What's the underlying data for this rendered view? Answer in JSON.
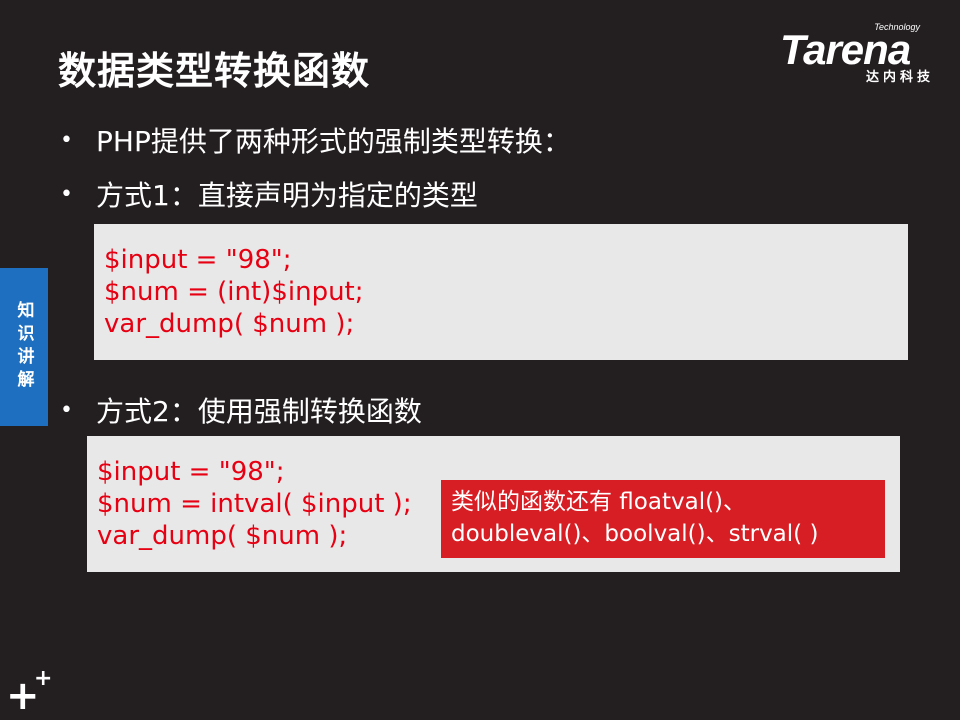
{
  "slide": {
    "title": "数据类型转换函数",
    "logo": {
      "word": "Tarena",
      "tagline": "Technology",
      "subtitle": "达内科技"
    },
    "side_tab": "知识讲解",
    "bullets": [
      "PHP提供了两种形式的强制类型转换：",
      "方式1：直接声明为指定的类型",
      "方式2：使用强制转换函数"
    ],
    "code_block_1": [
      "$input = \"98\";",
      "$num = (int)$input;",
      "var_dump( $num );"
    ],
    "code_block_2": [
      "$input = \"98\";",
      "$num = intval( $input );",
      "var_dump( $num );"
    ],
    "callout": [
      "类似的函数还有 floatval()、",
      "doubleval()、boolval()、strval( )"
    ],
    "colors": {
      "background": "#231f20",
      "code_text": "#e60012",
      "code_bg": "#e8e8e8",
      "callout_bg": "#d71e24",
      "side_tab_bg": "#1e6fbf"
    }
  }
}
